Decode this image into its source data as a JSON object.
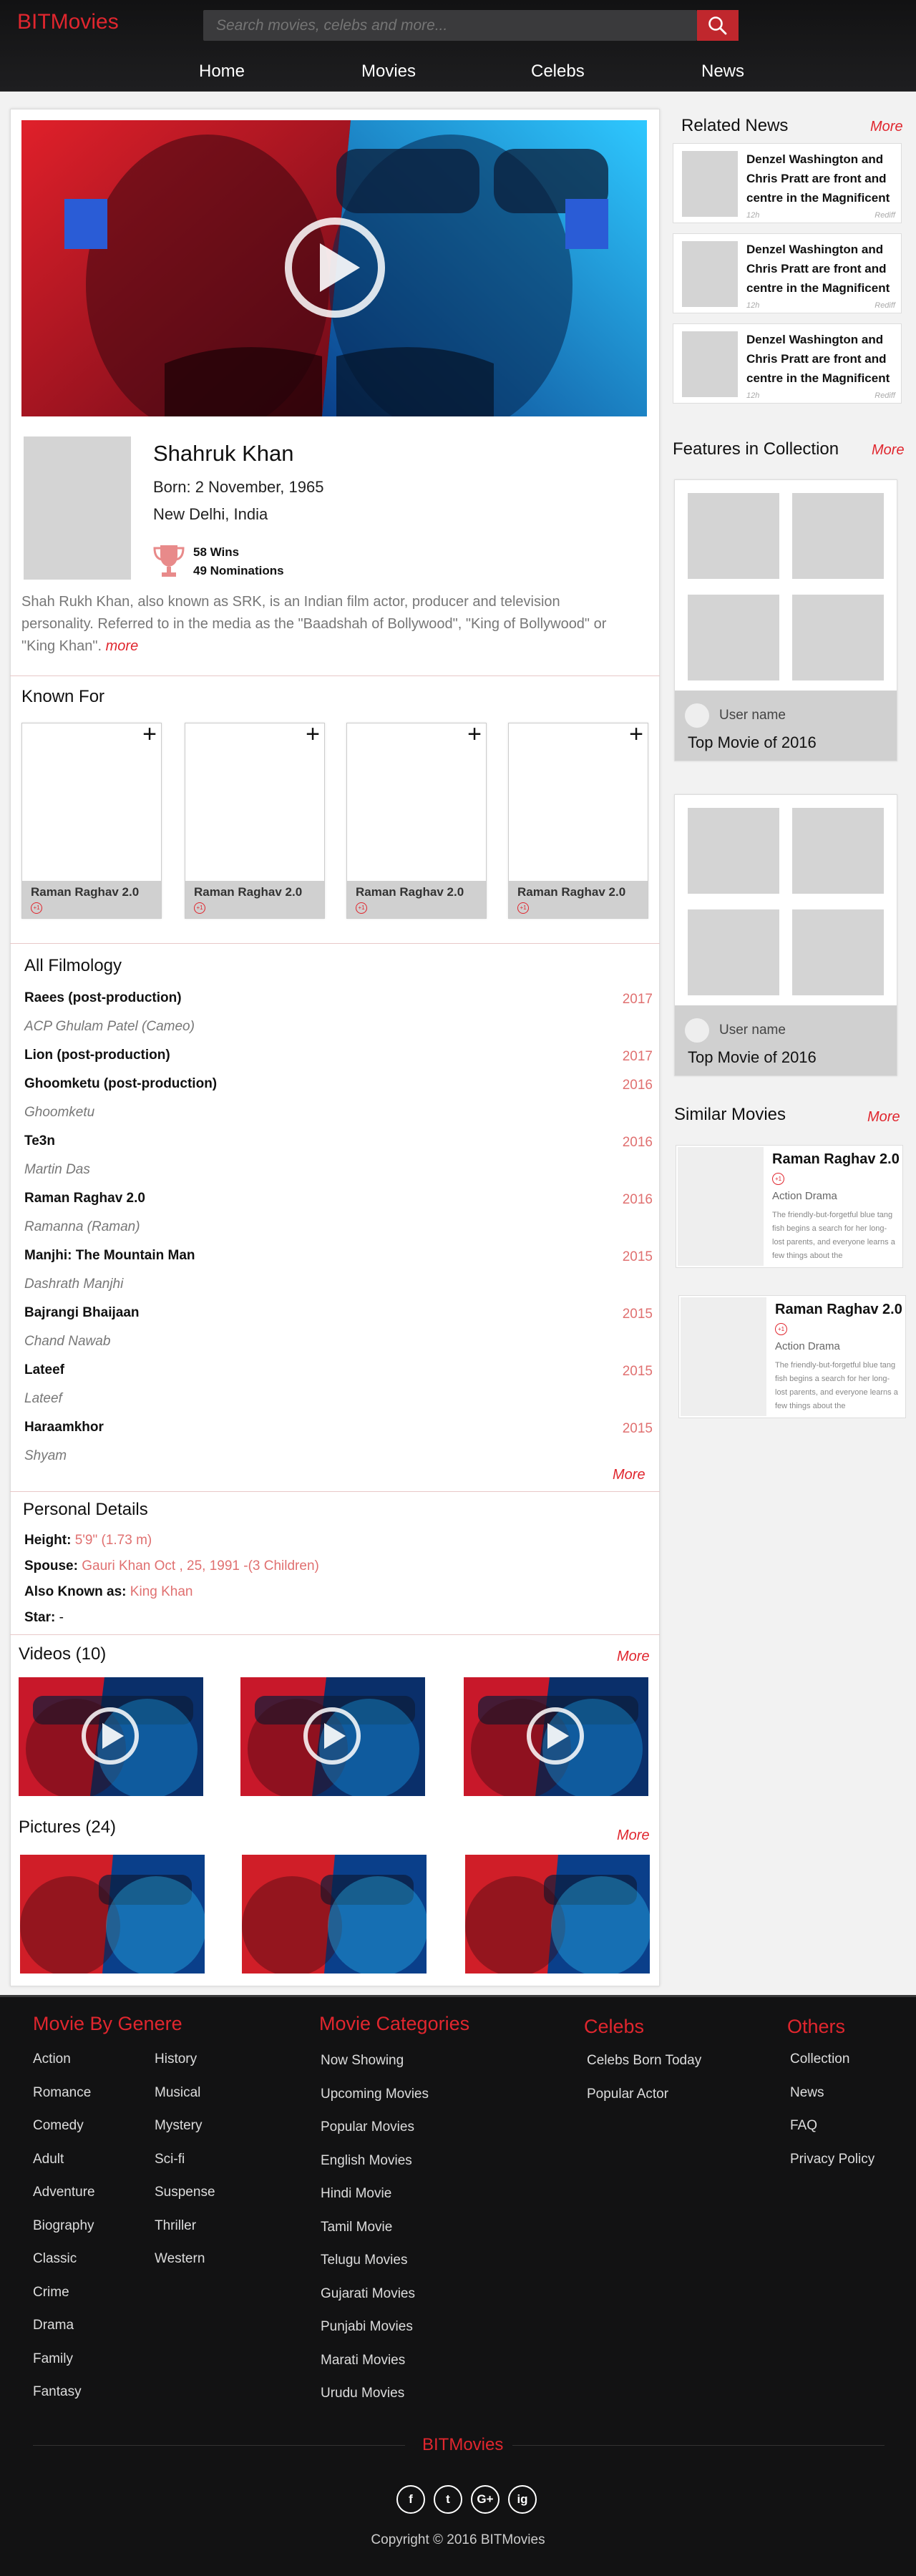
{
  "header": {
    "logo": "BITMovies",
    "search_placeholder": "Search movies, celebs and more...",
    "nav": [
      "Home",
      "Movies",
      "Celebs",
      "News"
    ]
  },
  "celeb": {
    "name": "Shahruk Khan",
    "born": "Born: 2 November, 1965",
    "place": "New Delhi, India",
    "wins": "58 Wins",
    "nominations": "49 Nominations",
    "bio": "Shah Rukh Khan, also known as SRK, is an Indian film actor, producer and television personality. Referred to in the media as the \"Baadshah of Bollywood\", \"King of Bollywood\" or \"King Khan\".",
    "bio_more": "more"
  },
  "known_for": {
    "title": "Known For",
    "items": [
      {
        "title": "Raman Raghav 2.0",
        "badge": "+1"
      },
      {
        "title": "Raman Raghav 2.0",
        "badge": "+1"
      },
      {
        "title": "Raman Raghav 2.0",
        "badge": "+1"
      },
      {
        "title": "Raman Raghav 2.0",
        "badge": "+1"
      }
    ]
  },
  "filmology": {
    "title": "All Filmology",
    "items": [
      {
        "title": "Raees (post-production)",
        "year": "2017",
        "role": "ACP Ghulam Patel (Cameo)"
      },
      {
        "title": "Lion (post-production)",
        "year": "2017",
        "role": ""
      },
      {
        "title": "Ghoomketu (post-production)",
        "year": "2016",
        "role": "Ghoomketu"
      },
      {
        "title": "Te3n",
        "year": "2016",
        "role": "Martin Das"
      },
      {
        "title": "Raman Raghav 2.0",
        "year": "2016",
        "role": "Ramanna (Raman)"
      },
      {
        "title": "Manjhi: The Mountain Man",
        "year": "2015",
        "role": "Dashrath Manjhi"
      },
      {
        "title": "Bajrangi Bhaijaan",
        "year": "2015",
        "role": "Chand Nawab"
      },
      {
        "title": "Lateef",
        "year": "2015",
        "role": "Lateef"
      },
      {
        "title": "Haraamkhor",
        "year": "2015",
        "role": "Shyam"
      }
    ],
    "more": "More"
  },
  "personal": {
    "title": "Personal Details",
    "height_label": "Height:",
    "height": "5'9\" (1.73 m)",
    "spouse_label": "Spouse:",
    "spouse": "Gauri Khan Oct , 25, 1991 -(3 Children)",
    "aka_label": "Also Known as:",
    "aka": "King Khan",
    "star_label": "Star:",
    "star": "-"
  },
  "videos": {
    "title": "Videos (10)",
    "more": "More"
  },
  "pictures": {
    "title": "Pictures (24)",
    "more": "More"
  },
  "sidebar": {
    "news_title": "Related News",
    "news_more": "More",
    "news": [
      {
        "text": "Denzel Washington and Chris Pratt are front and centre in the Magnificent",
        "time": "12h",
        "source": "Rediff"
      },
      {
        "text": "Denzel Washington and Chris Pratt are front and centre in the Magnificent",
        "time": "12h",
        "source": "Rediff"
      },
      {
        "text": "Denzel Washington and Chris Pratt are front and centre in the Magnificent",
        "time": "12h",
        "source": "Rediff"
      }
    ],
    "features_title": "Features in Collection",
    "features_more": "More",
    "collections": [
      {
        "user": "User name",
        "title": "Top Movie of 2016"
      },
      {
        "user": "User name",
        "title": "Top Movie of 2016"
      }
    ],
    "similar_title": "Similar Movies",
    "similar_more": "More",
    "similar": [
      {
        "title": "Raman Raghav 2.0",
        "badge": "+1",
        "genre": "Action  Drama",
        "desc": "The friendly-but-forgetful blue tang fish begins a search for her long-lost parents, and everyone learns a few things about the"
      },
      {
        "title": "Raman Raghav 2.0",
        "badge": "+1",
        "genre": "Action  Drama",
        "desc": "The friendly-but-forgetful blue tang fish begins a search for her long-lost parents, and everyone learns a few things about the"
      }
    ]
  },
  "footer": {
    "genre_title": "Movie By Genere",
    "genres_col1": [
      "Action",
      "Romance",
      "Comedy",
      "Adult",
      "Adventure",
      "Biography",
      "Classic",
      "Crime",
      "Drama",
      "Family",
      "Fantasy"
    ],
    "genres_col2": [
      "History",
      "Musical",
      "Mystery",
      "Sci-fi",
      "Suspense",
      "Thriller",
      "Western"
    ],
    "categories_title": "Movie Categories",
    "categories": [
      "Now Showing",
      "Upcoming Movies",
      "Popular Movies",
      "English Movies",
      "Hindi Movie",
      "Tamil Movie",
      "Telugu Movies",
      "Gujarati Movies",
      "Punjabi Movies",
      "Marati Movies",
      "Urudu Movies"
    ],
    "celebs_title": "Celebs",
    "celebs": [
      "Celebs Born Today",
      "Popular Actor"
    ],
    "others_title": "Others",
    "others": [
      "Collection",
      "News",
      "FAQ",
      "Privacy Policy"
    ],
    "brand": "BITMovies",
    "social": [
      "f",
      "t",
      "G+",
      "ig"
    ],
    "copyright": "Copyright © 2016 BITMovies"
  },
  "colors": {
    "accent": "#e0262e",
    "dark": "#121213",
    "light_red": "#e07070"
  }
}
